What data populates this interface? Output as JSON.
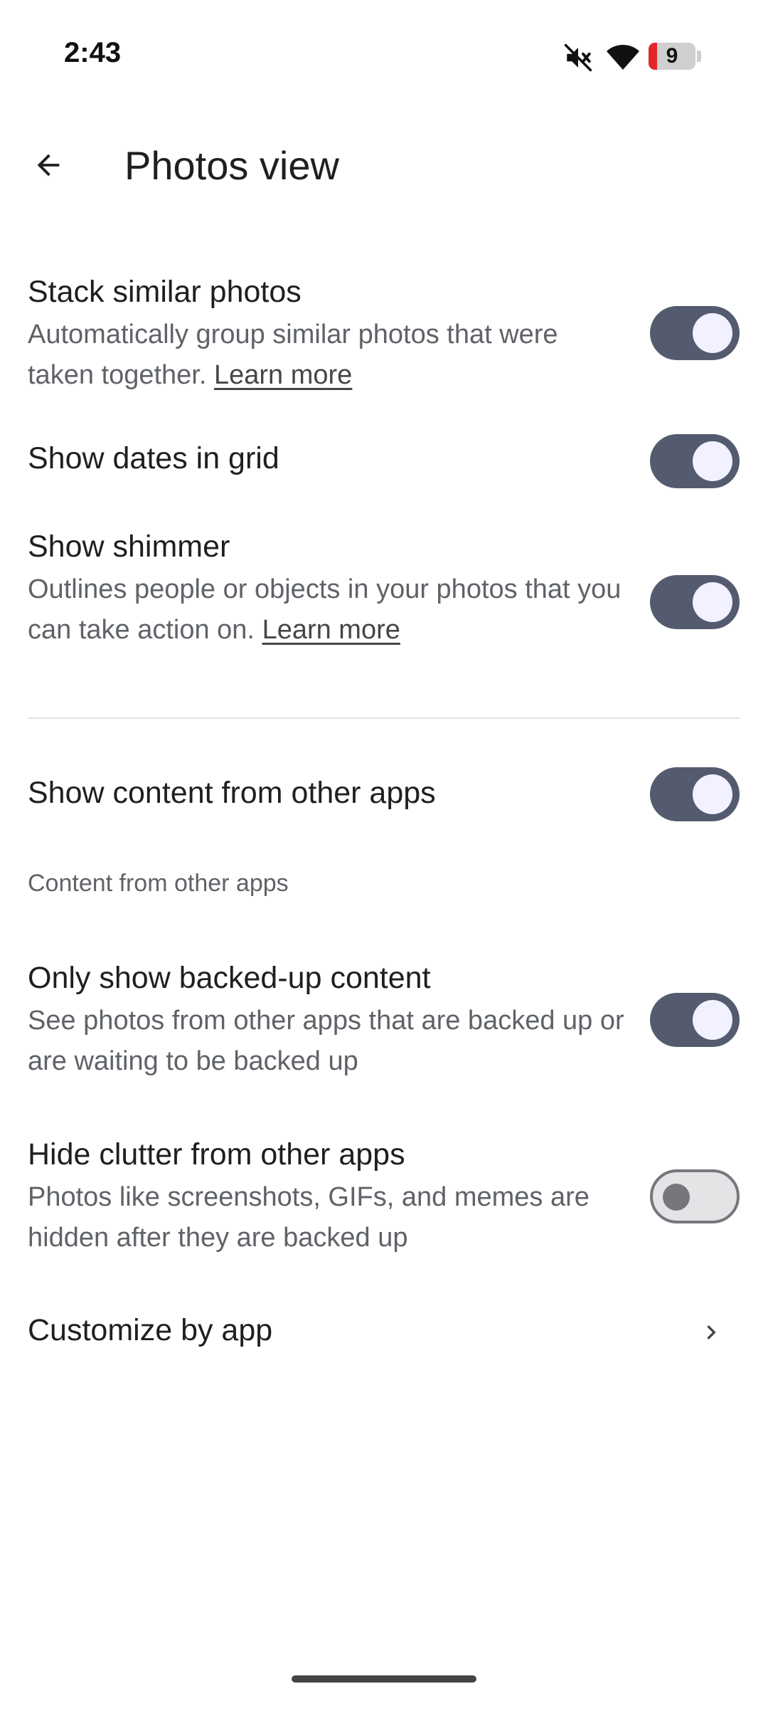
{
  "status_bar": {
    "time": "2:43",
    "battery_level": "9",
    "icons": [
      "mute-icon",
      "wifi-icon",
      "battery-icon"
    ]
  },
  "app_bar": {
    "title": "Photos view",
    "back_icon": "arrow-back-icon"
  },
  "settings": {
    "stack_similar": {
      "title": "Stack similar photos",
      "desc": "Automatically group similar photos that were taken together.",
      "link": "Learn more",
      "on": true
    },
    "show_dates": {
      "title": "Show dates in grid",
      "on": true
    },
    "show_shimmer": {
      "title": "Show shimmer",
      "desc": "Outlines people or objects in your photos that you can take action on.",
      "link": "Learn more",
      "on": true
    },
    "show_other_apps": {
      "title": "Show content from other apps",
      "on": true
    },
    "section_header": "Content from other apps",
    "backed_up_only": {
      "title": "Only show backed-up content",
      "desc": "See photos from other apps that are backed up or are waiting to be backed up",
      "on": true
    },
    "hide_clutter": {
      "title": "Hide clutter from other apps",
      "desc": "Photos like screenshots, GIFs, and memes are hidden after they are backed up",
      "on": false
    },
    "customize_by_app": {
      "title": "Customize by app",
      "icon": "chevron-right-icon"
    }
  },
  "colors": {
    "toggle_on": "#555b6e",
    "toggle_knob_on": "#f1f1ff",
    "toggle_off_track": "#e4e4e7",
    "toggle_off_outline": "#76777d"
  }
}
